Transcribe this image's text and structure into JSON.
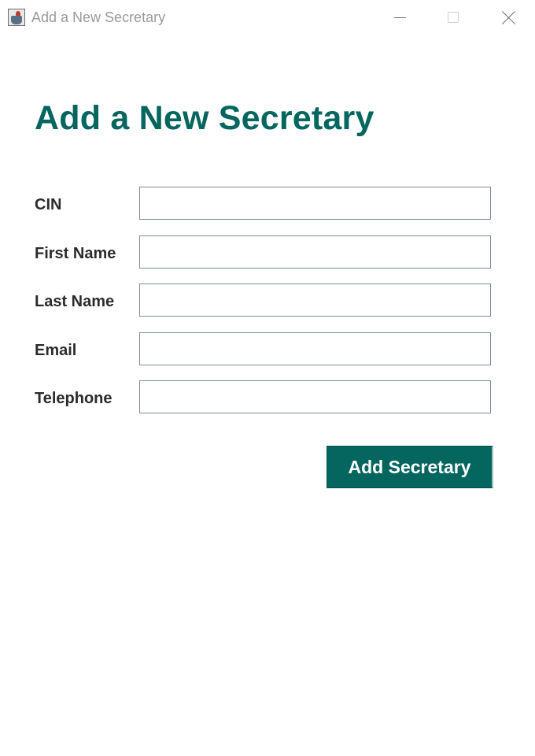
{
  "window": {
    "title": "Add a New Secretary",
    "icon": "java-cup-icon",
    "controls": [
      "minimize-icon",
      "maximize-icon",
      "close-icon"
    ]
  },
  "heading": "Add a New Secretary",
  "form": {
    "fields": [
      {
        "label": "CIN",
        "value": ""
      },
      {
        "label": "First Name",
        "value": ""
      },
      {
        "label": "Last Name",
        "value": ""
      },
      {
        "label": "Email",
        "value": ""
      },
      {
        "label": "Telephone",
        "value": ""
      }
    ],
    "submit_label": "Add Secretary"
  },
  "colors": {
    "accent": "#05665f",
    "label_text": "#2b2b2b",
    "input_border": "#7e8b93",
    "title_text": "#9a9a9a"
  }
}
